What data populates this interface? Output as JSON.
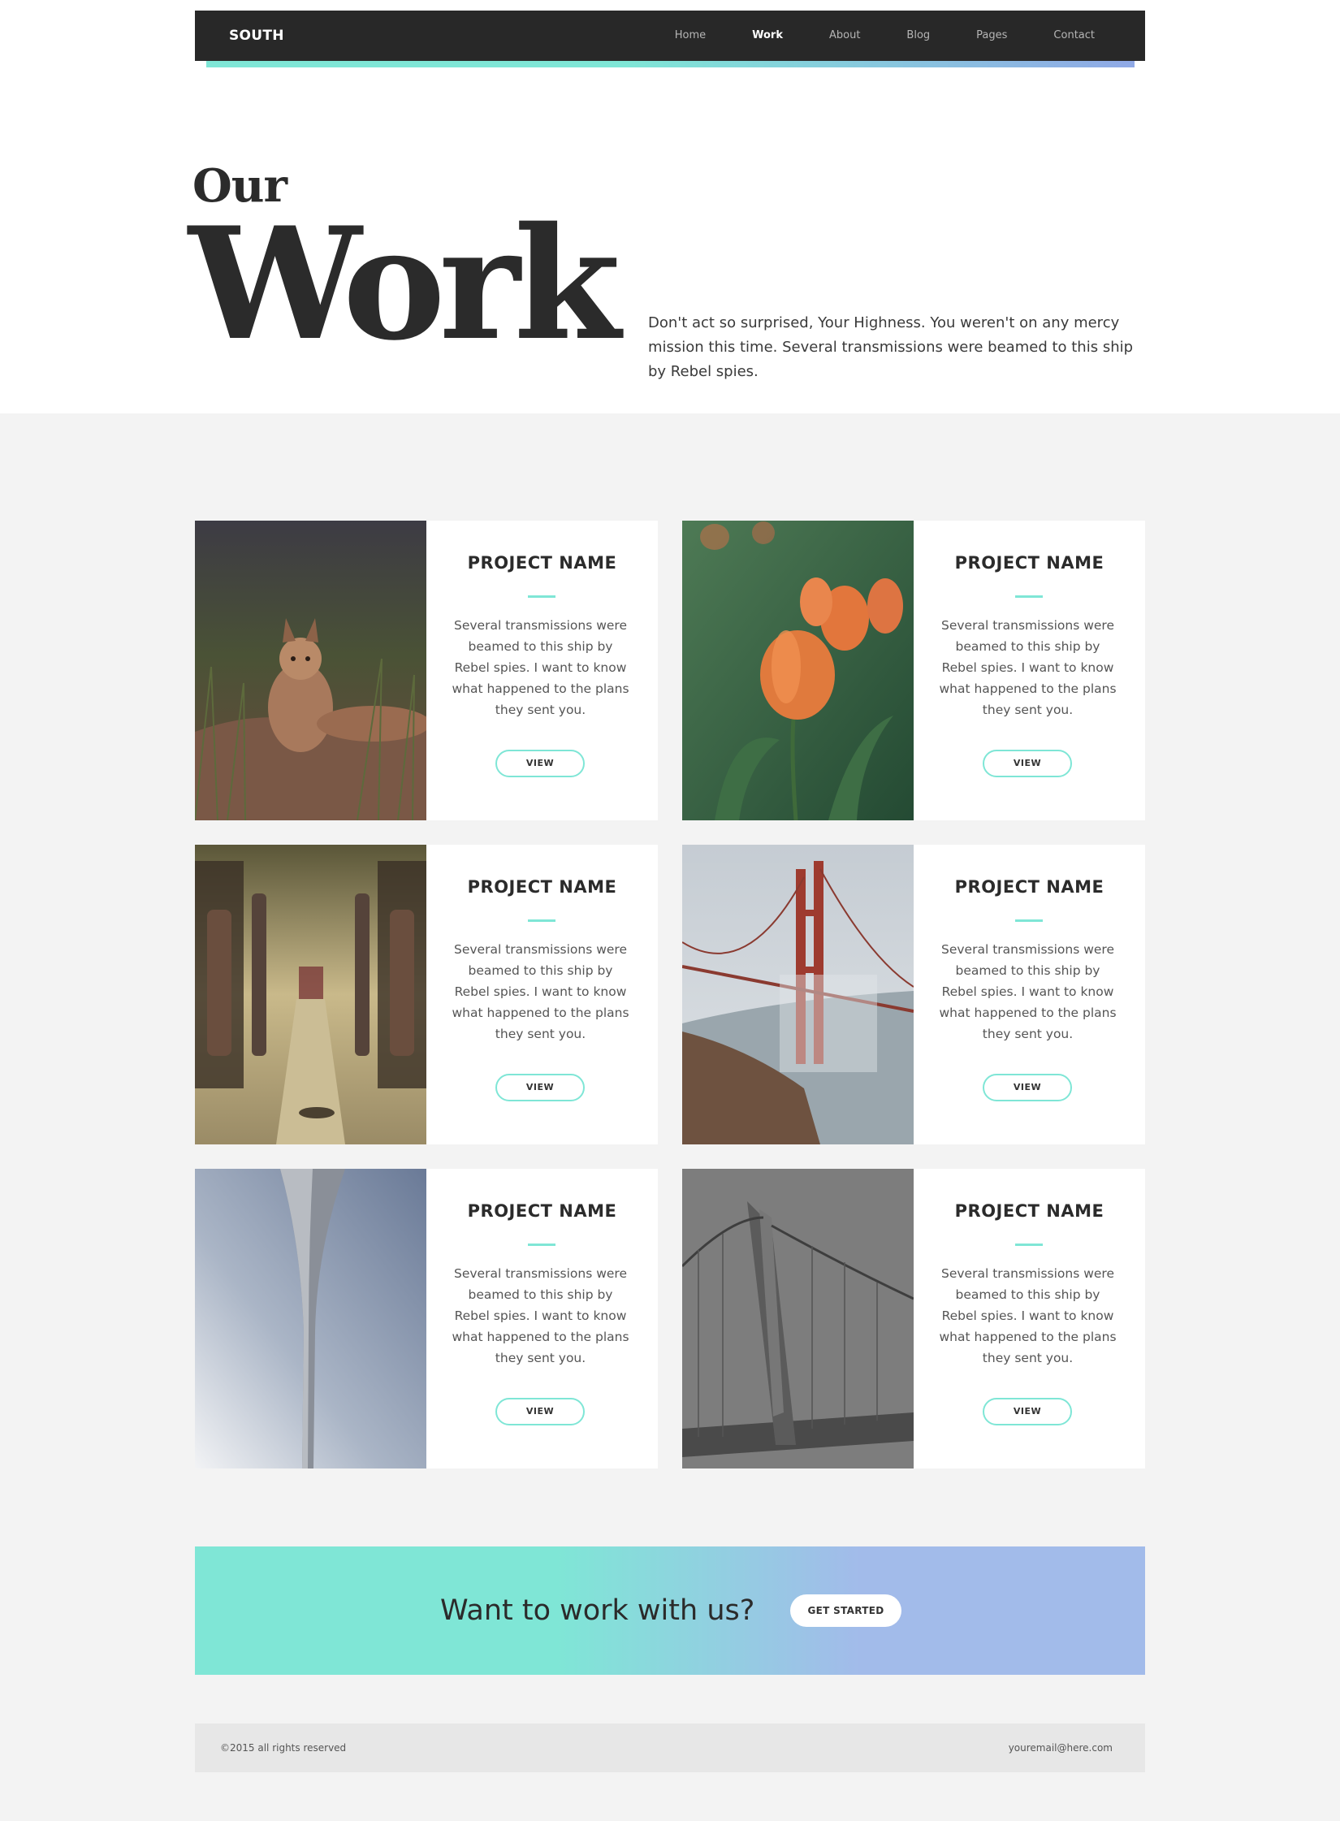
{
  "nav": {
    "brand": "SOUTH",
    "items": [
      {
        "label": "Home"
      },
      {
        "label": "Work",
        "active": true
      },
      {
        "label": "About"
      },
      {
        "label": "Blog"
      },
      {
        "label": "Pages"
      },
      {
        "label": "Contact"
      }
    ]
  },
  "hero": {
    "title_small": "Our",
    "title_large": "Work",
    "text": "Don't act so surprised, Your Highness. You weren't on any mercy mission this time. Several transmissions were beamed to this ship by Rebel spies."
  },
  "projects": [
    {
      "title": "PROJECT NAME",
      "description": "Several transmissions were beamed to this ship by Rebel spies. I want to know what happened to the plans they sent you.",
      "button": "VIEW",
      "image": "fox-photo"
    },
    {
      "title": "PROJECT NAME",
      "description": "Several transmissions were beamed to this ship by Rebel spies. I want to know what happened to the plans they sent you.",
      "button": "VIEW",
      "image": "tulips-photo"
    },
    {
      "title": "PROJECT NAME",
      "description": "Several transmissions were beamed to this ship by Rebel spies. I want to know what happened to the plans they sent you.",
      "button": "VIEW",
      "image": "bus-interior-photo"
    },
    {
      "title": "PROJECT NAME",
      "description": "Several transmissions were beamed to this ship by Rebel spies. I want to know what happened to the plans they sent you.",
      "button": "VIEW",
      "image": "golden-gate-fog-photo"
    },
    {
      "title": "PROJECT NAME",
      "description": "Several transmissions were beamed to this ship by Rebel spies. I want to know what happened to the plans they sent you.",
      "button": "VIEW",
      "image": "arch-sky-photo"
    },
    {
      "title": "PROJECT NAME",
      "description": "Several transmissions were beamed to this ship by Rebel spies. I want to know what happened to the plans they sent you.",
      "button": "VIEW",
      "image": "bridge-aerial-photo"
    }
  ],
  "cta": {
    "text": "Want to work with us?",
    "button": "GET STARTED"
  },
  "footer": {
    "copyright": "©2015 all rights reserved",
    "email": "youremail@here.com"
  },
  "colors": {
    "accent": "#7fe6d6",
    "accent_blue": "#a2bbea",
    "nav_bg": "#282828",
    "page_bg": "#f3f3f3"
  }
}
